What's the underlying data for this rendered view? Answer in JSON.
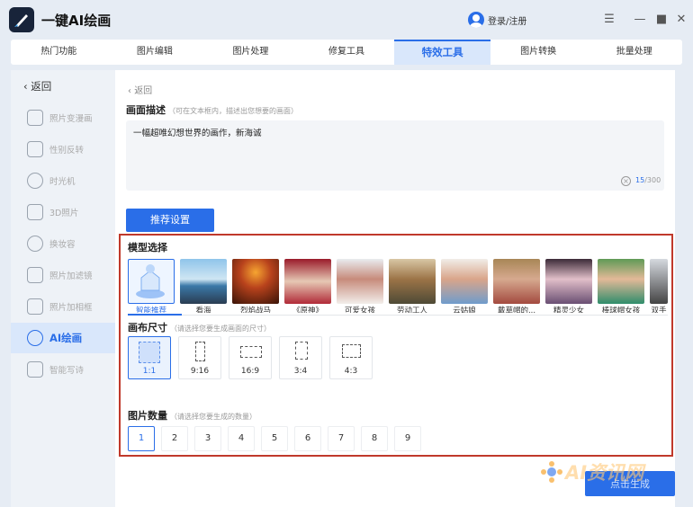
{
  "app": {
    "title": "一键AI绘画",
    "login": "登录/注册",
    "accent": "#2a6ee8"
  },
  "tabs": [
    {
      "label": "热门功能",
      "active": false
    },
    {
      "label": "图片编辑",
      "active": false
    },
    {
      "label": "图片处理",
      "active": false
    },
    {
      "label": "修复工具",
      "active": false
    },
    {
      "label": "特效工具",
      "active": true
    },
    {
      "label": "图片转换",
      "active": false
    },
    {
      "label": "批量处理",
      "active": false
    }
  ],
  "sidebar": {
    "back_label": "返回",
    "items": [
      {
        "label": "照片变漫画",
        "icon": "cartoon-icon"
      },
      {
        "label": "性别反转",
        "icon": "gender-icon"
      },
      {
        "label": "时光机",
        "icon": "clock-icon"
      },
      {
        "label": "3D照片",
        "icon": "cube-icon"
      },
      {
        "label": "换妆容",
        "icon": "makeup-icon"
      },
      {
        "label": "照片加滤镜",
        "icon": "filter-icon"
      },
      {
        "label": "照片加相框",
        "icon": "frame-icon"
      },
      {
        "label": "AI绘画",
        "icon": "ai-icon",
        "active": true
      },
      {
        "label": "智能写诗",
        "icon": "poem-icon"
      }
    ]
  },
  "main": {
    "back_label": "返回",
    "desc_title": "画面描述",
    "desc_hint": "（可在文本框内，描述出您想要的画面）",
    "desc_value": "一幅超唯幻想世界的画作，新海诚",
    "counter_current": "15",
    "counter_max": "/300",
    "recommend_label": "推荐设置",
    "model_title": "模型选择",
    "models": [
      {
        "label": "智能推荐",
        "selected": true
      },
      {
        "label": "看海"
      },
      {
        "label": "烈焰战马"
      },
      {
        "label": "《原神》"
      },
      {
        "label": "可爱女孩"
      },
      {
        "label": "劳动工人"
      },
      {
        "label": "云姑娘"
      },
      {
        "label": "戴草帽的..."
      },
      {
        "label": "精灵少女"
      },
      {
        "label": "棒球帽女孩"
      },
      {
        "label": "双手"
      }
    ],
    "canvas_title": "画布尺寸",
    "canvas_hint": "（请选择您要生成画面的尺寸）",
    "sizes": [
      {
        "label": "1:1",
        "selected": true
      },
      {
        "label": "9:16"
      },
      {
        "label": "16:9"
      },
      {
        "label": "3:4"
      },
      {
        "label": "4:3"
      }
    ],
    "count_title": "图片数量",
    "count_hint": "（请选择您要生成的数量）",
    "counts": [
      "1",
      "2",
      "3",
      "4",
      "5",
      "6",
      "7",
      "8",
      "9"
    ],
    "count_selected": "1",
    "generate_label": "点击生成"
  },
  "watermark": "AI资讯网"
}
